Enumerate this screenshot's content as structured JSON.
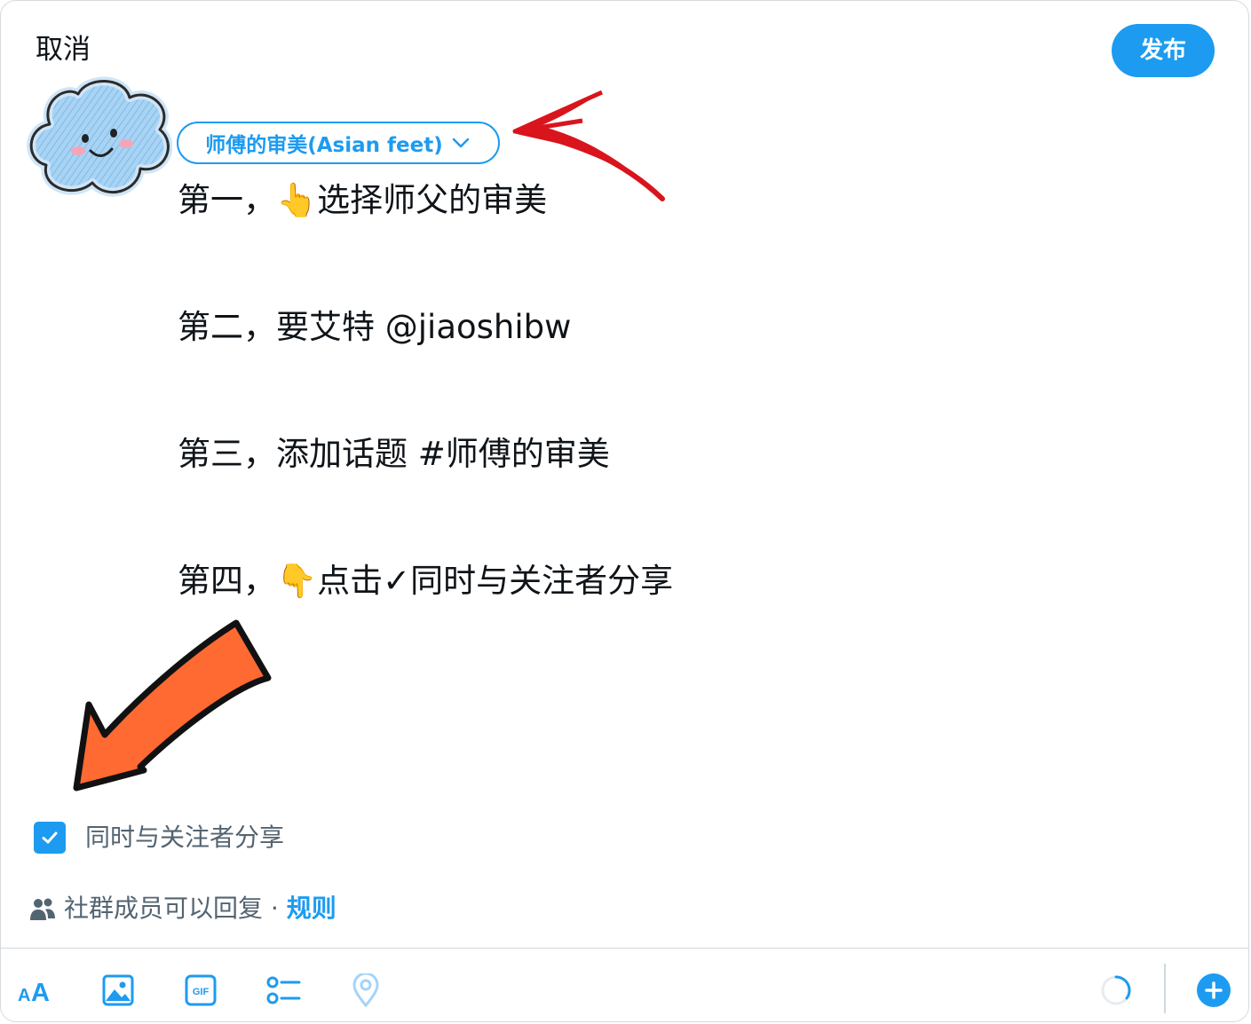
{
  "header": {
    "cancel_label": "取消",
    "publish_label": "发布"
  },
  "audience": {
    "label": "师傅的审美(Asian feet)",
    "icon": "chevron-down-icon"
  },
  "composer": {
    "lines": [
      "第一，👆选择师父的审美",
      "第二，要艾特 @jiaoshibw",
      "第三，添加话题  #师傅的审美",
      "第四，👇点击✓同时与关注者分享"
    ]
  },
  "share_option": {
    "label": "同时与关注者分享",
    "checked": true
  },
  "reply_setting": {
    "icon": "people-icon",
    "text": "社群成员可以回复 · ",
    "rules_label": "规则"
  },
  "toolbar": {
    "items": [
      "text-format-icon",
      "image-icon",
      "gif-icon",
      "poll-icon",
      "location-icon",
      "progress-ring-icon",
      "add-icon"
    ]
  },
  "colors": {
    "accent": "#1d9bf0",
    "annotation_red": "#d9141c",
    "annotation_orange": "#ff6a33",
    "muted_text": "#536471"
  }
}
